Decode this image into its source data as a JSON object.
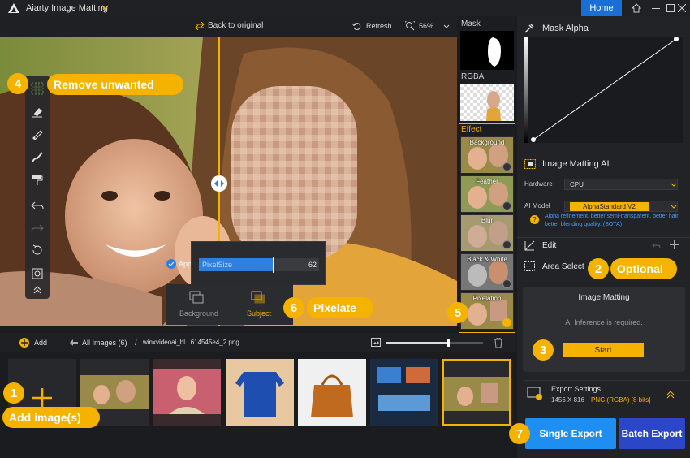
{
  "app": {
    "title": "Aiarty Image Matting",
    "home_label": "Home"
  },
  "canvas_toolbar": {
    "back_to_original": "Back to original",
    "refresh": "Refresh",
    "zoom": "56%"
  },
  "callouts": {
    "remove_unwanted": {
      "number": "4",
      "label": "Remove unwanted"
    },
    "optional": {
      "number": "2",
      "label": "Optional"
    },
    "start_step": {
      "number": "3"
    },
    "pixelate": {
      "number": "6",
      "label": "Pixelate"
    },
    "effect_step": {
      "number": "5"
    },
    "add_images": {
      "number": "1",
      "label": "Add image(s)"
    },
    "export_step": {
      "number": "7"
    }
  },
  "pixel_popup": {
    "apply_label": "App",
    "slider_label": "PixelSize",
    "value": "62",
    "fill_fraction": 0.62,
    "background_label": "Background",
    "subject_label": "Subject"
  },
  "mask_column": {
    "mask_label": "Mask",
    "rgba_label": "RGBA",
    "effect_label": "Effect",
    "effects": [
      {
        "label": "Background"
      },
      {
        "label": "Feather"
      },
      {
        "label": "Blur"
      },
      {
        "label": "Black & White"
      },
      {
        "label": "Pixelation"
      }
    ]
  },
  "right_panel": {
    "mask_alpha": "Mask Alpha",
    "image_matting_ai": "Image Matting AI",
    "hardware_label": "Hardware",
    "hardware_value": "CPU",
    "ai_model_label": "AI Model",
    "ai_model_value": "AlphaStandard  V2",
    "ai_model_desc": "Alpha refinement, better semi-transparent, better hair, better blending quality. (SOTA)",
    "edit": "Edit",
    "area_select": "Area Select",
    "matting_dialog": {
      "title": "Image Matting",
      "message": "AI Inference is required.",
      "start": "Start"
    },
    "export_settings": "Export Settings",
    "export_size": "1456 X 816",
    "export_format": "PNG (RGBA) [8 bits]"
  },
  "bottom_bar": {
    "add": "Add",
    "all_images": "All Images (6)",
    "separator": "/",
    "filename": "winxvideoai_bl...614545e4_2.png"
  },
  "export": {
    "single": "Single Export",
    "batch": "Batch Export"
  },
  "colors": {
    "accent": "#f5b300",
    "primary_blue": "#1a6fd6",
    "single_export": "#1e8ff0",
    "batch_export": "#2b46c6",
    "model_highlight": "#f5b300"
  }
}
